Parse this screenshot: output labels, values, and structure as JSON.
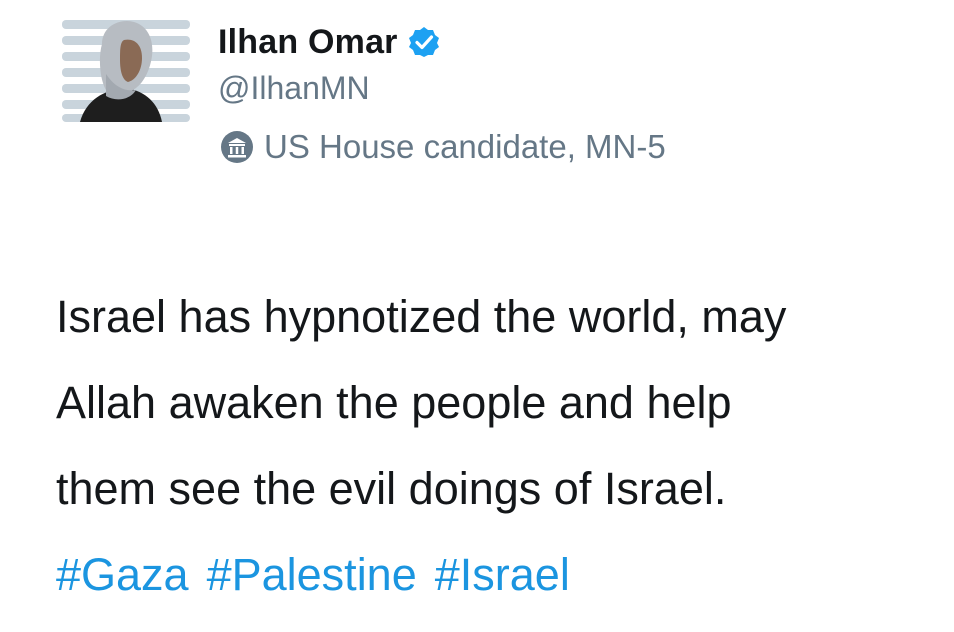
{
  "author": {
    "display_name": "Ilhan Omar",
    "handle": "@IlhanMN",
    "location": "US House candidate, MN-5",
    "verified": true
  },
  "tweet": {
    "lines": [
      "Israel has hypnotized the world, may",
      "Allah awaken the people and help",
      "them see the evil doings of Israel."
    ],
    "hashtags": [
      "#Gaza",
      "#Palestine",
      "#Israel"
    ]
  },
  "icons": {
    "verified": "verified-badge-icon",
    "location": "government-building-icon"
  },
  "colors": {
    "text": "#14171a",
    "secondary": "#657786",
    "link": "#1b95e0",
    "verified": "#1da1f2"
  }
}
